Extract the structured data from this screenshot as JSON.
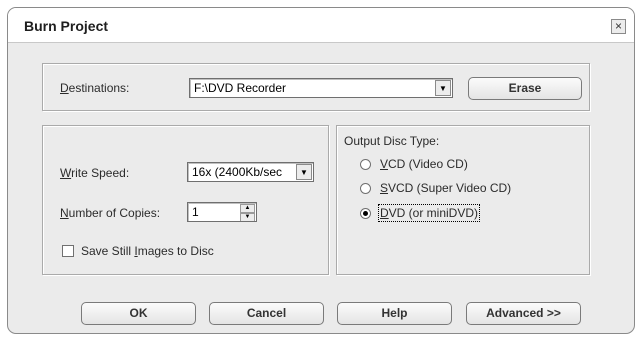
{
  "window": {
    "title": "Burn Project",
    "close_glyph": "×"
  },
  "destinations": {
    "label_prefix": "",
    "label_accel": "D",
    "label_rest": "estinations:",
    "value": "F:\\DVD Recorder",
    "erase_label": "Erase"
  },
  "settings": {
    "write_speed": {
      "label_accel": "W",
      "label_rest": "rite Speed:",
      "value": "16x (2400Kb/sec"
    },
    "copies": {
      "label_accel": "N",
      "label_rest": "umber of Copies:",
      "value": "1"
    },
    "save_still": {
      "label_prefix": "Save Still ",
      "label_accel": "I",
      "label_rest": "mages to Disc",
      "checked": false
    }
  },
  "output": {
    "title": "Output Disc Type:",
    "options": [
      {
        "accel": "V",
        "rest": "CD (Video CD)",
        "selected": false
      },
      {
        "accel": "S",
        "rest": "VCD (Super Video CD)",
        "selected": false
      },
      {
        "accel": "D",
        "rest": "VD (or miniDVD)",
        "selected": true
      }
    ]
  },
  "buttons": {
    "ok": "OK",
    "cancel": "Cancel",
    "help": "Help",
    "advanced": "Advanced >>"
  }
}
